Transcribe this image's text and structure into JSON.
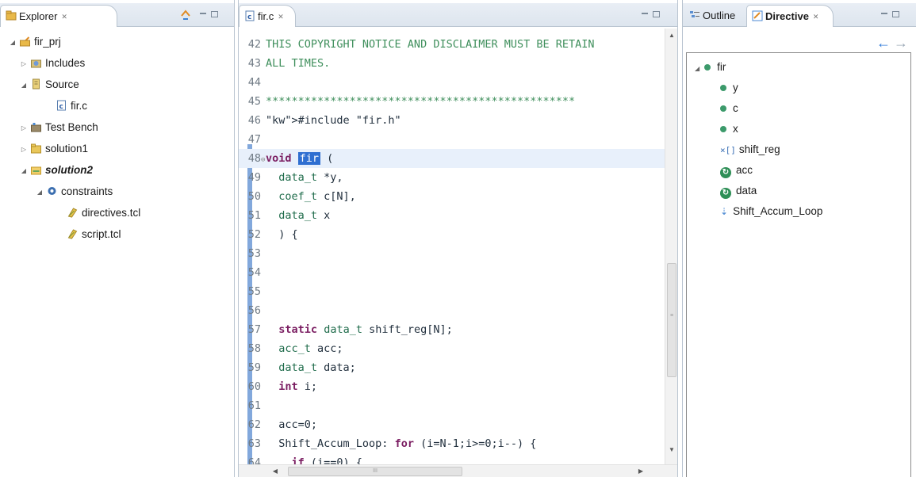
{
  "explorer": {
    "tab_label": "Explorer",
    "tree": [
      {
        "label": "fir_prj",
        "twisty": "expanded",
        "icon": "project-icon",
        "style": "normal"
      },
      {
        "label": "Includes",
        "twisty": "collapsed",
        "icon": "includes-icon",
        "style": "normal"
      },
      {
        "label": "Source",
        "twisty": "expanded",
        "icon": "source-folder-icon",
        "style": "normal"
      },
      {
        "label": "fir.c",
        "twisty": "",
        "icon": "c-file-icon",
        "style": "normal"
      },
      {
        "label": "Test Bench",
        "twisty": "collapsed",
        "icon": "testbench-icon",
        "style": "normal"
      },
      {
        "label": "solution1",
        "twisty": "collapsed",
        "icon": "folder-icon",
        "style": "normal"
      },
      {
        "label": "solution2",
        "twisty": "expanded",
        "icon": "solution-folder-icon",
        "style": "bold-italic"
      },
      {
        "label": "constraints",
        "twisty": "expanded",
        "icon": "gear-icon",
        "style": "normal"
      },
      {
        "label": "directives.tcl",
        "twisty": "",
        "icon": "tcl-file-icon",
        "style": "normal"
      },
      {
        "label": "script.tcl",
        "twisty": "",
        "icon": "tcl-file-icon",
        "style": "normal"
      }
    ]
  },
  "editor": {
    "tab_label": "fir.c",
    "lines": [
      {
        "num": "42",
        "text": "THIS COPYRIGHT NOTICE AND DISCLAIMER MUST BE RETAIN"
      },
      {
        "num": "43",
        "text": "ALL TIMES."
      },
      {
        "num": "44",
        "text": ""
      },
      {
        "num": "45",
        "text": "************************************************"
      },
      {
        "num": "46",
        "text": "#include \"fir.h\""
      },
      {
        "num": "47",
        "text": ""
      },
      {
        "num": "48",
        "text": "void fir ("
      },
      {
        "num": "49",
        "text": "  data_t *y,"
      },
      {
        "num": "50",
        "text": "  coef_t c[N],"
      },
      {
        "num": "51",
        "text": "  data_t x"
      },
      {
        "num": "52",
        "text": "  ) {"
      },
      {
        "num": "53",
        "text": ""
      },
      {
        "num": "54",
        "text": ""
      },
      {
        "num": "55",
        "text": ""
      },
      {
        "num": "56",
        "text": ""
      },
      {
        "num": "57",
        "text": "  static data_t shift_reg[N];"
      },
      {
        "num": "58",
        "text": "  acc_t acc;"
      },
      {
        "num": "59",
        "text": "  data_t data;"
      },
      {
        "num": "60",
        "text": "  int i;"
      },
      {
        "num": "61",
        "text": ""
      },
      {
        "num": "62",
        "text": "  acc=0;"
      },
      {
        "num": "63",
        "text": "  Shift_Accum_Loop: for (i=N-1;i>=0;i--) {"
      },
      {
        "num": "64",
        "text": "    if (i==0) {"
      }
    ],
    "selected_word": "fir",
    "current_line": "48"
  },
  "right": {
    "outline_tab": "Outline",
    "directive_tab": "Directive",
    "tree": [
      {
        "label": "fir",
        "kind": "function"
      },
      {
        "label": "y",
        "kind": "port"
      },
      {
        "label": "c",
        "kind": "port"
      },
      {
        "label": "x",
        "kind": "port"
      },
      {
        "label": "shift_reg",
        "kind": "array"
      },
      {
        "label": "acc",
        "kind": "variable"
      },
      {
        "label": "data",
        "kind": "variable"
      },
      {
        "label": "Shift_Accum_Loop",
        "kind": "loop"
      }
    ]
  },
  "colors": {
    "accent": "#2f6fd1",
    "tab_bar": "#dde5ee",
    "keyword": "#7b1e62",
    "comment": "#3f8f5c",
    "string": "#2a00ff"
  }
}
